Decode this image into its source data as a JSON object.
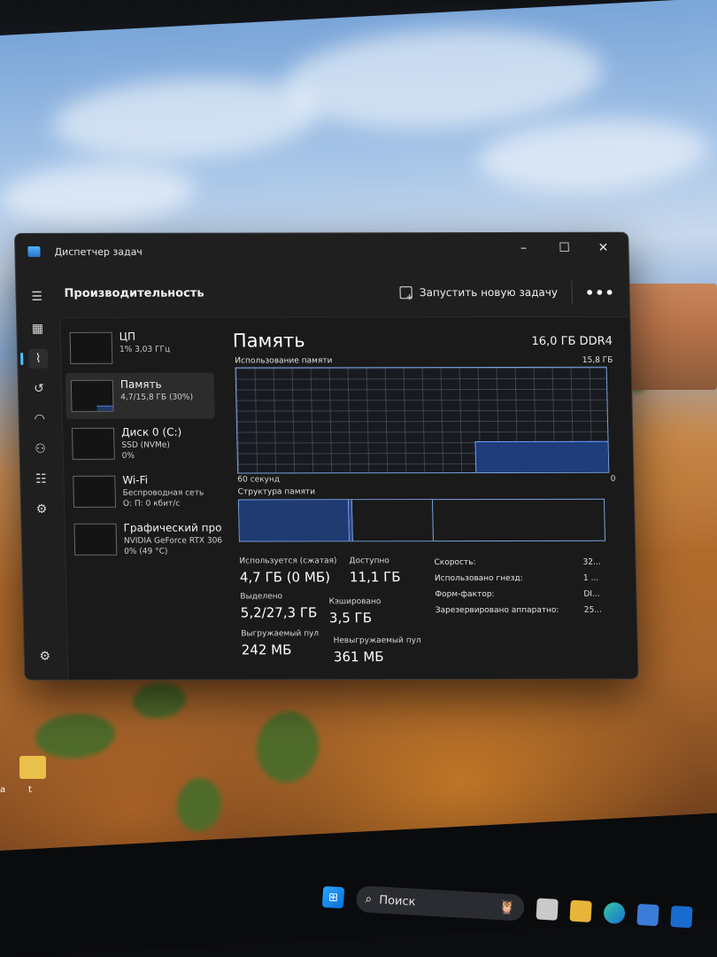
{
  "window": {
    "title": "Диспетчер задач",
    "controls": {
      "minimize": "–",
      "maximize": "☐",
      "close": "✕"
    }
  },
  "toolbar": {
    "section": "Производительность",
    "run_new_task": "Запустить новую задачу",
    "more": "•••"
  },
  "nav": [
    {
      "icon": "hamburger-menu-icon",
      "glyph": "☰"
    },
    {
      "icon": "processes-icon",
      "glyph": "▦"
    },
    {
      "icon": "performance-icon",
      "glyph": "⌇",
      "active": true
    },
    {
      "icon": "app-history-icon",
      "glyph": "↺"
    },
    {
      "icon": "startup-apps-icon",
      "glyph": "◠"
    },
    {
      "icon": "users-icon",
      "glyph": "⚇"
    },
    {
      "icon": "details-icon",
      "glyph": "☷"
    },
    {
      "icon": "services-icon",
      "glyph": "⚙"
    },
    {
      "icon": "settings-icon",
      "glyph": "⚙"
    }
  ],
  "resources": [
    {
      "name": "ЦП",
      "sub1": "1% 3,03 ГГц",
      "sub2": "",
      "usage": 0.01
    },
    {
      "name": "Память",
      "sub1": "4,7/15,8 ГБ (30%)",
      "sub2": "",
      "usage": 0.3,
      "active": true
    },
    {
      "name": "Диск 0 (C:)",
      "sub1": "SSD (NVMe)",
      "sub2": "0%",
      "usage": 0.0
    },
    {
      "name": "Wi-Fi",
      "sub1": "Беспроводная сеть",
      "sub2": "О: П: 0 кбит/с",
      "usage": 0.0
    },
    {
      "name": "Графический про",
      "sub1": "NVIDIA GeForce RTX 306",
      "sub2": "0% (49 °C)",
      "usage": 0.0
    }
  ],
  "memory": {
    "title": "Память",
    "spec": "16,0 ГБ DDR4",
    "usage_label": "Использование памяти",
    "usage_max": "15,8 ГБ",
    "axis_left": "60 секунд",
    "axis_right": "0",
    "usage_fraction": 0.3,
    "composition_label": "Структура памяти",
    "composition": {
      "in_use": 0.3,
      "modified": 0.01,
      "standby": 0.22
    },
    "stats": {
      "in_use_label": "Используется (сжатая)",
      "in_use_value": "4,7 ГБ (0 МБ)",
      "available_label": "Доступно",
      "available_value": "11,1 ГБ",
      "committed_label": "Выделено",
      "committed_value": "5,2/27,3 ГБ",
      "cached_label": "Кэшировано",
      "cached_value": "3,5 ГБ",
      "paged_label": "Выгружаемый пул",
      "paged_value": "242 МБ",
      "nonpaged_label": "Невыгружаемый пул",
      "nonpaged_value": "361 МБ"
    },
    "details": [
      {
        "label": "Скорость:",
        "value": "32..."
      },
      {
        "label": "Использовано гнезд:",
        "value": "1 ..."
      },
      {
        "label": "Форм-фактор:",
        "value": "DI..."
      },
      {
        "label": "Зарезервировано аппаратно:",
        "value": "25..."
      }
    ]
  },
  "taskbar": {
    "search_placeholder": "Поиск",
    "search_glyph": "⌕",
    "owl_glyph": "🦉"
  },
  "desktop": {
    "folder_label": "t",
    "left_label": "a"
  }
}
